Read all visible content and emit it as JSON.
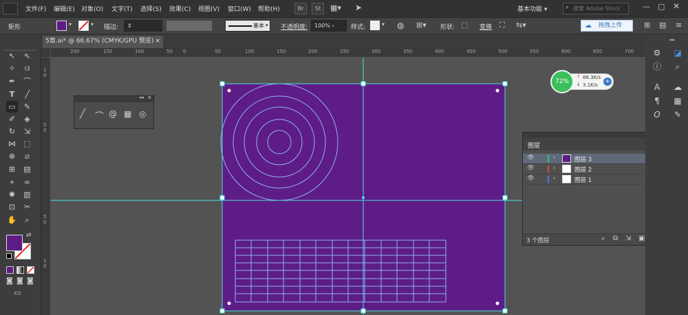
{
  "menu": [
    "文件(F)",
    "编辑(E)",
    "对象(O)",
    "文字(T)",
    "选择(S)",
    "效果(C)",
    "视图(V)",
    "窗口(W)",
    "帮助(H)"
  ],
  "app_buttons": [
    "Br",
    "St"
  ],
  "workspace": "基本功能",
  "search_placeholder": "搜索 Adobe Stock",
  "upload_label": "拖拽上传",
  "control": {
    "tool_name": "矩形",
    "stroke_label": "描边:",
    "stroke_style": "基本",
    "opacity_label": "不透明度:",
    "opacity_value": "100%",
    "style_label": "样式:",
    "shape_label": "形状:",
    "transform_label": "变换"
  },
  "document_tab": {
    "title": "5章.ai* @ 66.67% (CMYK/GPU 预览)",
    "close": "×"
  },
  "hruler_ticks": [
    "200",
    "150",
    "100",
    "50",
    "0",
    "50",
    "100",
    "150",
    "200",
    "250",
    "300",
    "350",
    "400",
    "450",
    "500",
    "550",
    "600",
    "650",
    "700"
  ],
  "vruler_ticks": [
    "1",
    "0",
    "5",
    "0",
    "5",
    "0",
    "1",
    "0"
  ],
  "layers": {
    "title": "图层",
    "rows": [
      {
        "name": "图层 3",
        "color": "#3fbf6f"
      },
      {
        "name": "图层 2",
        "color": "#e04646"
      },
      {
        "name": "图层 1",
        "color": "#4a78d8"
      }
    ],
    "footer": "3 个图层"
  },
  "speed": {
    "percent": "72%",
    "up": "66.3K/s",
    "down": "3.1K/s"
  },
  "colors": {
    "artboard": "#5e1c86",
    "guide": "#4ee0e0",
    "fill": "#5e1c86"
  },
  "icons": [
    "selection-tool",
    "direct-selection-tool",
    "magic-wand",
    "lasso",
    "pen",
    "curvature",
    "type",
    "line-segment",
    "rectangle",
    "paintbrush",
    "shaper",
    "eraser",
    "rotate",
    "scale",
    "width",
    "free-transform",
    "shape-builder",
    "perspective",
    "mesh",
    "gradient",
    "eyedropper",
    "blend",
    "symbol-sprayer",
    "column-graph",
    "artboard-tool",
    "slice",
    "hand",
    "zoom"
  ]
}
